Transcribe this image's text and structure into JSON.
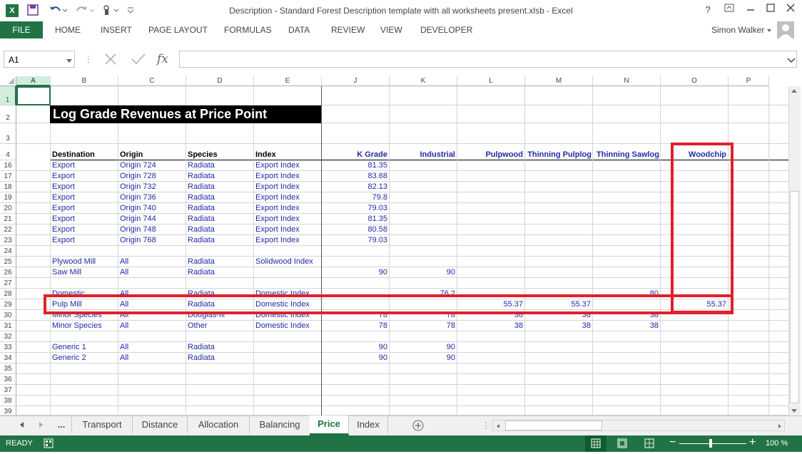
{
  "window": {
    "title": "Description - Standard Forest Description template with all worksheets present.xlsb - Excel",
    "help": "?",
    "user": "Simon Walker"
  },
  "ribbon": {
    "file": "FILE",
    "tabs": [
      "HOME",
      "INSERT",
      "PAGE LAYOUT",
      "FORMULAS",
      "DATA",
      "REVIEW",
      "VIEW",
      "DEVELOPER"
    ]
  },
  "formula_bar": {
    "name_box": "A1",
    "fx": "fx",
    "formula": ""
  },
  "columns": [
    "A",
    "B",
    "C",
    "D",
    "E",
    "J",
    "K",
    "L",
    "M",
    "N",
    "O",
    "P"
  ],
  "rows": [
    "1",
    "2",
    "3",
    "4",
    "16",
    "17",
    "18",
    "19",
    "20",
    "21",
    "22",
    "23",
    "24",
    "25",
    "26",
    "27",
    "28",
    "29",
    "30",
    "31",
    "32",
    "33",
    "34",
    "35",
    "36",
    "37",
    "38",
    "39"
  ],
  "sheet_title": "Log Grade Revenues at Price Point",
  "headers": {
    "destination": "Destination",
    "origin": "Origin",
    "species": "Species",
    "index": "Index",
    "k_grade": "K Grade",
    "industrial": "Industrial",
    "pulpwood": "Pulpwood",
    "thinning_pulplog": "Thinning Pulplog",
    "thinning_sawlog": "Thinning Sawlog",
    "woodchip": "Woodchip"
  },
  "data_rows": [
    {
      "row": "16",
      "dest": "Export",
      "origin": "Origin 724",
      "species": "Radiata",
      "index": "Export Index",
      "k": "81.35"
    },
    {
      "row": "17",
      "dest": "Export",
      "origin": "Origin 728",
      "species": "Radiata",
      "index": "Export Index",
      "k": "83.68"
    },
    {
      "row": "18",
      "dest": "Export",
      "origin": "Origin 732",
      "species": "Radiata",
      "index": "Export Index",
      "k": "82.13"
    },
    {
      "row": "19",
      "dest": "Export",
      "origin": "Origin 736",
      "species": "Radiata",
      "index": "Export Index",
      "k": "79.8"
    },
    {
      "row": "20",
      "dest": "Export",
      "origin": "Origin 740",
      "species": "Radiata",
      "index": "Export Index",
      "k": "79.03"
    },
    {
      "row": "21",
      "dest": "Export",
      "origin": "Origin 744",
      "species": "Radiata",
      "index": "Export Index",
      "k": "81.35"
    },
    {
      "row": "22",
      "dest": "Export",
      "origin": "Origin 748",
      "species": "Radiata",
      "index": "Export Index",
      "k": "80.58"
    },
    {
      "row": "23",
      "dest": "Export",
      "origin": "Origin 768",
      "species": "Radiata",
      "index": "Export Index",
      "k": "79.03"
    },
    {
      "row": "25",
      "dest": "Plywood Mill",
      "origin": "All",
      "species": "Radiata",
      "index": "Solidwood Index"
    },
    {
      "row": "26",
      "dest": "Saw Mill",
      "origin": "All",
      "species": "Radiata",
      "k": "90",
      "ind": "90"
    },
    {
      "row": "28",
      "dest": "Domestic",
      "origin": "All",
      "species": "Radiata",
      "index": "Domestic Index",
      "ind": "76.2",
      "ts": "80"
    },
    {
      "row": "29",
      "dest": "Pulp Mill",
      "origin": "All",
      "species": "Radiata",
      "index": "Domestic Index",
      "pw": "55.37",
      "tp": "55.37",
      "wc": "55.37"
    },
    {
      "row": "30",
      "dest": "Minor Species",
      "origin": "All",
      "species": "Douglas-fir",
      "index": "Domestic Index",
      "k": "78",
      "ind": "78",
      "pw": "38",
      "tp": "38",
      "ts": "38"
    },
    {
      "row": "31",
      "dest": "Minor Species",
      "origin": "All",
      "species": "Other",
      "index": "Domestic Index",
      "k": "78",
      "ind": "78",
      "pw": "38",
      "tp": "38",
      "ts": "38"
    },
    {
      "row": "33",
      "dest": "Generic 1",
      "origin": "All",
      "species": "Radiata",
      "k": "90",
      "ind": "90"
    },
    {
      "row": "34",
      "dest": "Generic 2",
      "origin": "All",
      "species": "Radiata",
      "k": "90",
      "ind": "90"
    }
  ],
  "sheet_tabs": {
    "ellipsis": "...",
    "tabs": [
      "Transport",
      "Distance",
      "Allocation",
      "Balancing",
      "Price",
      "Index"
    ],
    "active": "Price"
  },
  "status": {
    "ready": "READY",
    "zoom": "100 %"
  },
  "colors": {
    "excel_green": "#217346",
    "highlight_red": "#e0202b",
    "cell_blue": "#1f2aa8"
  }
}
